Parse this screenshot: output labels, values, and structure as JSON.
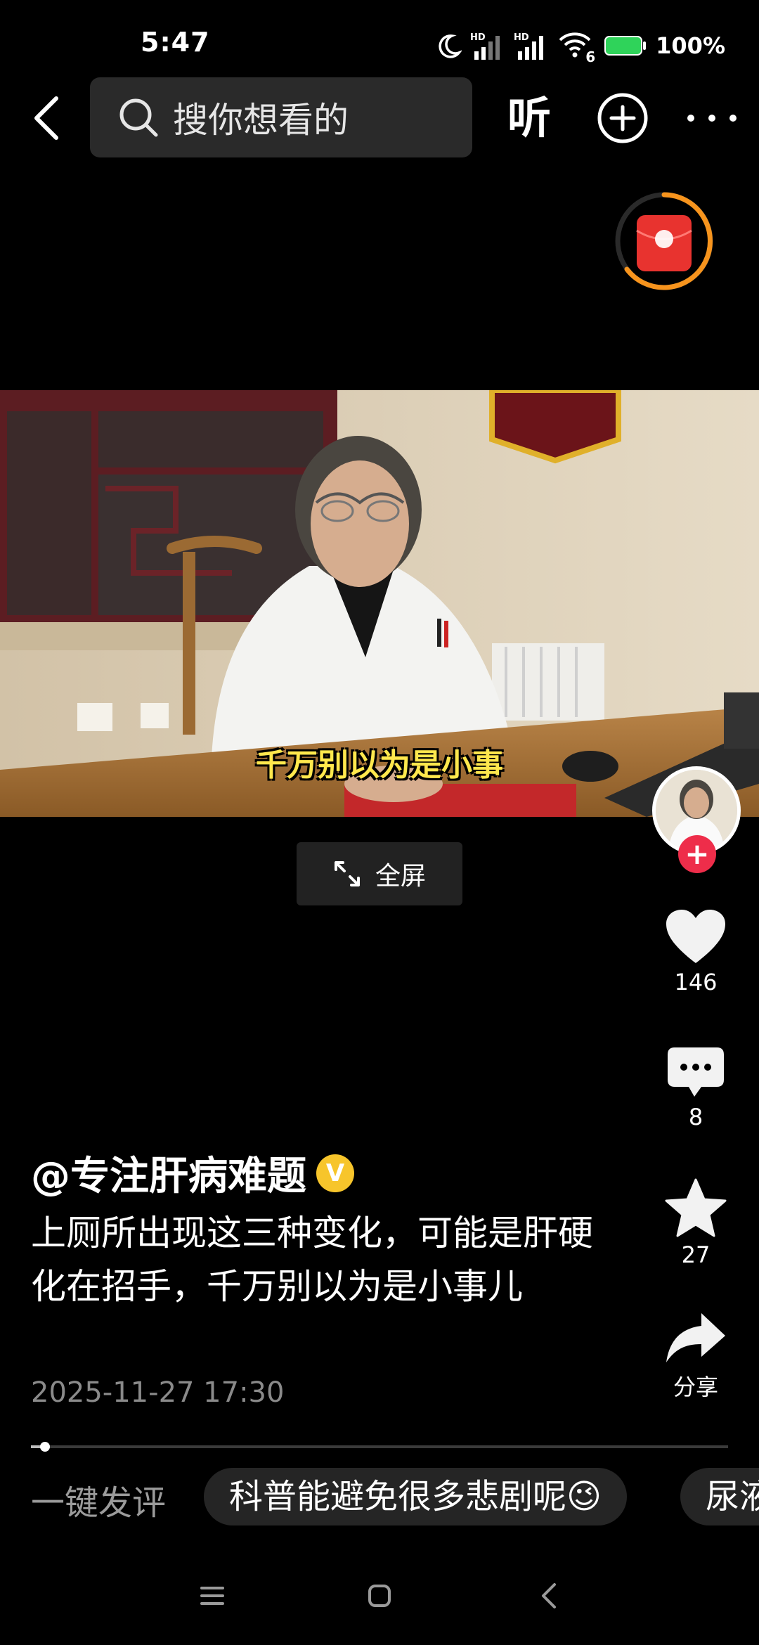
{
  "status_bar": {
    "time": "5:47",
    "wifi_label": "6",
    "battery": "100%"
  },
  "top_nav": {
    "search_placeholder": "搜你想看的",
    "listen_label": "听"
  },
  "video": {
    "subtitle": "千万别以为是小事",
    "fullscreen_label": "全屏"
  },
  "rail": {
    "like_count": "146",
    "comment_count": "8",
    "favorite_count": "27",
    "share_label": "分享",
    "follow_symbol": "+"
  },
  "post": {
    "author": "@专注肝病难题",
    "verified_mark": "V",
    "description": "上厕所出现这三种变化，可能是肝硬化在招手，千万别以为是小事儿",
    "date": "2025-11-27 17:30",
    "progress": 0.02
  },
  "comment_bar": {
    "label": "一键发评",
    "chips": [
      "科普能避免很多悲剧呢😉",
      "尿液"
    ]
  },
  "colors": {
    "accent_red": "#ee2d4a",
    "verified_gold": "#f7c52b",
    "subtitle_yellow": "#ffe84d"
  }
}
